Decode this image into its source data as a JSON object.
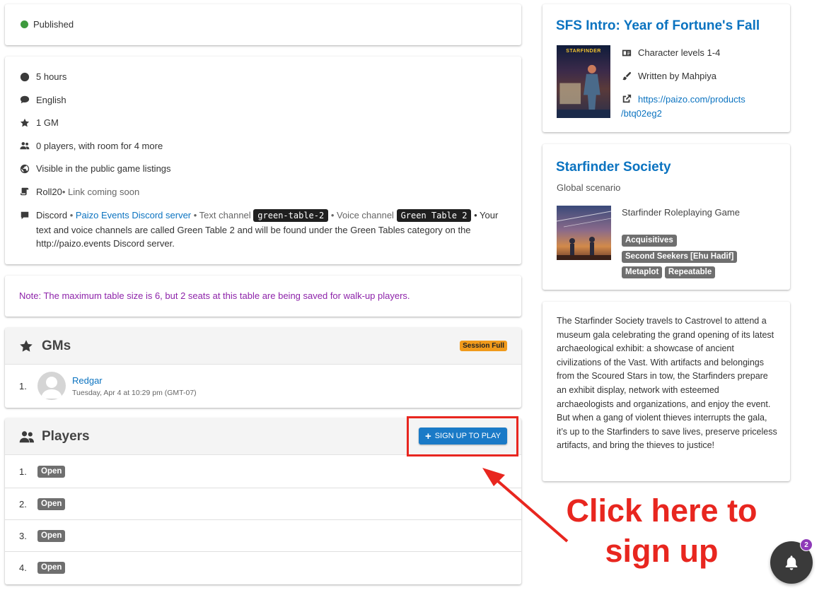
{
  "status": {
    "label": "Published",
    "color": "#3d9a3d"
  },
  "details": {
    "duration": "5 hours",
    "language": "English",
    "gm_count": "1 GM",
    "players": "0 players, with room for 4 more",
    "visibility": "Visible in the public game listings",
    "vtt_name": "Roll20",
    "vtt_note": " • Link coming soon",
    "discord_label": "Discord",
    "sep1": " • ",
    "discord_link": "Paizo Events Discord server",
    "text_channel_label": " • Text channel ",
    "text_channel": "green-table-2",
    "voice_channel_label": " • Voice channel ",
    "voice_channel": "Green Table 2",
    "discord_tail": " • Your text and voice channels are called Green Table 2 and will be found under the Green Tables category on the http://paizo.events Discord server."
  },
  "note": "Note: The maximum table size is 6, but 2 seats at this table are being saved for walk-up players.",
  "gms": {
    "title": "GMs",
    "badge": "Session Full",
    "list": [
      {
        "num": "1.",
        "name": "Redgar",
        "time": "Tuesday, Apr 4 at 10:29 pm (GMT-07)"
      }
    ]
  },
  "players_section": {
    "title": "Players",
    "signup_label": "SIGN UP TO PLAY",
    "slots": [
      {
        "num": "1.",
        "status": "Open"
      },
      {
        "num": "2.",
        "status": "Open"
      },
      {
        "num": "3.",
        "status": "Open"
      },
      {
        "num": "4.",
        "status": "Open"
      }
    ]
  },
  "adventure": {
    "title": "SFS Intro: Year of Fortune's Fall",
    "levels": "Character levels 1-4",
    "author": "Written by Mahpiya",
    "url_line1": "https://paizo.com/products",
    "url_line2": "/btq02eg2",
    "cover_text": "STARFINDER"
  },
  "campaign": {
    "title": "Starfinder Society",
    "subtitle": "Global scenario",
    "system": "Starfinder Roleplaying Game",
    "tags": [
      "Acquisitives",
      "Second Seekers [Ehu Hadif]",
      "Metaplot",
      "Repeatable"
    ]
  },
  "description": "The Starfinder Society travels to Castrovel to attend a museum gala celebrating the grand opening of its latest archaeological exhibit: a showcase of ancient civilizations of the Vast. With artifacts and belongings from the Scoured Stars in tow, the Starfinders prepare an exhibit display, network with esteemed archaeologists and organizations, and enjoy the event. But when a gang of violent thieves interrupts the gala, it’s up to the Starfinders to save lives, preserve priceless artifacts, and bring the thieves to justice!",
  "annotation": {
    "line1": "Click here to",
    "line2": "sign up",
    "color": "#e8261f"
  },
  "notifications": {
    "count": "2"
  }
}
